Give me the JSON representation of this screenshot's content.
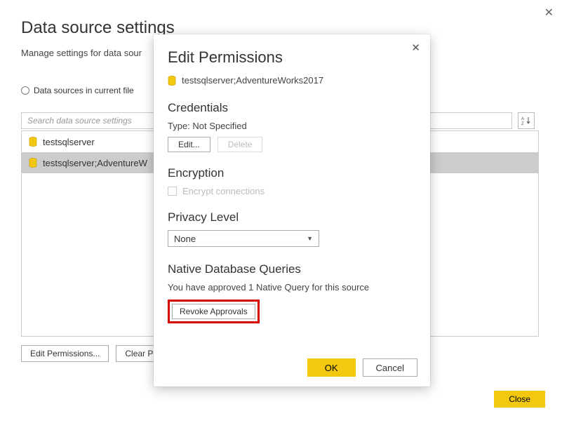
{
  "page": {
    "title": "Data source settings",
    "subtitle": "Manage settings for data sour",
    "radio_label": "Data sources in current file",
    "search_placeholder": "Search data source settings"
  },
  "sources": [
    {
      "name": "testsqlserver"
    },
    {
      "name": "testsqlserver;AdventureW"
    }
  ],
  "footer": {
    "edit_permissions": "Edit Permissions...",
    "clear_permissions": "Clear Perm",
    "close": "Close"
  },
  "modal": {
    "title": "Edit Permissions",
    "source": "testsqlserver;AdventureWorks2017",
    "credentials": {
      "heading": "Credentials",
      "type_label": "Type: Not Specified",
      "edit": "Edit...",
      "delete": "Delete"
    },
    "encryption": {
      "heading": "Encryption",
      "checkbox_label": "Encrypt connections"
    },
    "privacy": {
      "heading": "Privacy Level",
      "selected": "None"
    },
    "native": {
      "heading": "Native Database Queries",
      "message": "You have approved 1 Native Query for this source",
      "revoke": "Revoke Approvals"
    },
    "ok": "OK",
    "cancel": "Cancel"
  }
}
